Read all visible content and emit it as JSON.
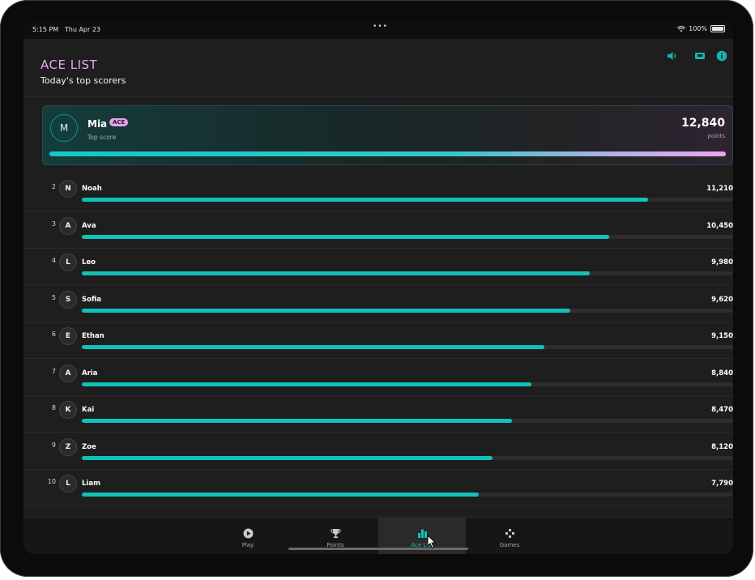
{
  "status_bar": {
    "time": "5:15 PM",
    "date": "Thu Apr 23",
    "dots": "•••",
    "battery_pct": "100%"
  },
  "header": {
    "title": "ACE LIST",
    "subtitle": "Today's top scorers",
    "icons": [
      "speaker-icon",
      "screen-icon",
      "info-icon"
    ]
  },
  "top_player": {
    "initial": "M",
    "name": "Mia",
    "badge": "ACE",
    "subtitle": "Top score",
    "score": "12,840",
    "unit": "points",
    "progress": 1.0
  },
  "leaderboard": [
    {
      "rank": "2",
      "initial": "N",
      "name": "Noah",
      "score": "11,210",
      "progress": 0.87
    },
    {
      "rank": "3",
      "initial": "A",
      "name": "Ava",
      "score": "10,450",
      "progress": 0.81
    },
    {
      "rank": "4",
      "initial": "L",
      "name": "Leo",
      "score": "9,980",
      "progress": 0.78
    },
    {
      "rank": "5",
      "initial": "S",
      "name": "Sofia",
      "score": "9,620",
      "progress": 0.75
    },
    {
      "rank": "6",
      "initial": "E",
      "name": "Ethan",
      "score": "9,150",
      "progress": 0.71
    },
    {
      "rank": "7",
      "initial": "A",
      "name": "Aria",
      "score": "8,840",
      "progress": 0.69
    },
    {
      "rank": "8",
      "initial": "K",
      "name": "Kai",
      "score": "8,470",
      "progress": 0.66
    },
    {
      "rank": "9",
      "initial": "Z",
      "name": "Zoe",
      "score": "8,120",
      "progress": 0.63
    },
    {
      "rank": "10",
      "initial": "L",
      "name": "Liam",
      "score": "7,790",
      "progress": 0.61
    }
  ],
  "tabs": [
    {
      "label": "Play",
      "icon": "play-icon",
      "active": false
    },
    {
      "label": "Points",
      "icon": "trophy-icon",
      "active": false
    },
    {
      "label": "Ace List",
      "icon": "bar-chart-icon",
      "active": true
    },
    {
      "label": "Games",
      "icon": "gamepad-icon",
      "active": false
    }
  ],
  "colors": {
    "accent": "#12c0bb",
    "title": "#e7a6ef",
    "badge": "#e6a2ea",
    "background": "#1e1e1e"
  }
}
